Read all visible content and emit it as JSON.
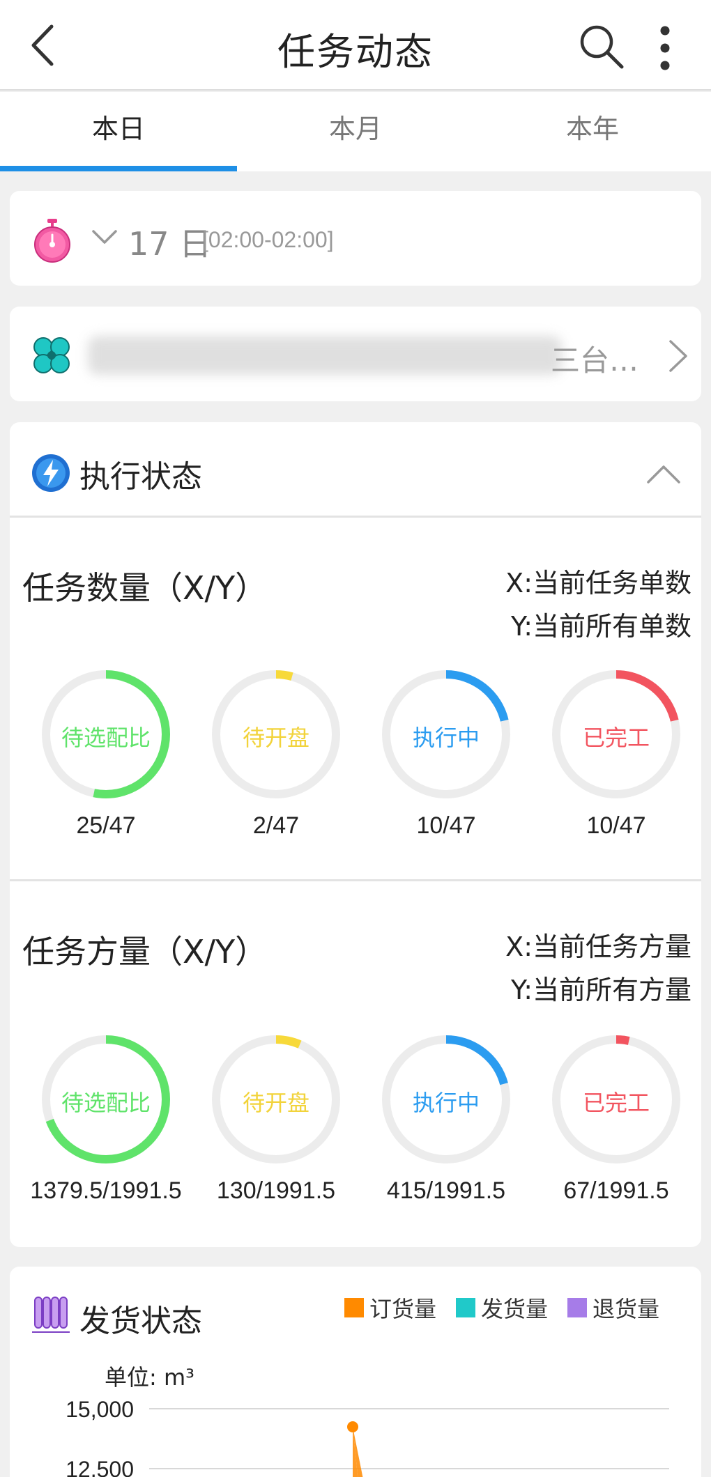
{
  "header": {
    "title": "任务动态"
  },
  "tabs": [
    {
      "label": "本日",
      "active": true
    },
    {
      "label": "本月",
      "active": false
    },
    {
      "label": "本年",
      "active": false
    }
  ],
  "date_filter": {
    "day": "17 日",
    "range": "[02:00-02:00]"
  },
  "station": {
    "visible_text": "三台…"
  },
  "exec_status": {
    "title": "执行状态",
    "task_count": {
      "title": "任务数量（X/Y）",
      "legend_x": "X:当前任务单数",
      "legend_y": "Y:当前所有单数",
      "items": [
        {
          "label": "待选配比",
          "value": "25/47",
          "fraction": 0.532,
          "color": "#5fe36a"
        },
        {
          "label": "待开盘",
          "value": "2/47",
          "fraction": 0.043,
          "color": "#f7d93a"
        },
        {
          "label": "执行中",
          "value": "10/47",
          "fraction": 0.213,
          "color": "#2b9cf0"
        },
        {
          "label": "已完工",
          "value": "10/47",
          "fraction": 0.213,
          "color": "#f2545f"
        }
      ]
    },
    "task_volume": {
      "title": "任务方量（X/Y）",
      "legend_x": "X:当前任务方量",
      "legend_y": "Y:当前所有方量",
      "items": [
        {
          "label": "待选配比",
          "value": "1379.5/1991.5",
          "fraction": 0.693,
          "color": "#5fe36a"
        },
        {
          "label": "待开盘",
          "value": "130/1991.5",
          "fraction": 0.065,
          "color": "#f7d93a"
        },
        {
          "label": "执行中",
          "value": "415/1991.5",
          "fraction": 0.208,
          "color": "#2b9cf0"
        },
        {
          "label": "已完工",
          "value": "67/1991.5",
          "fraction": 0.034,
          "color": "#f2545f"
        }
      ]
    }
  },
  "ship_status": {
    "title": "发货状态",
    "unit": "单位: m³",
    "legend": [
      {
        "label": "订货量",
        "color": "#ff8a00"
      },
      {
        "label": "发货量",
        "color": "#20c9c9"
      },
      {
        "label": "退货量",
        "color": "#a67ce8"
      }
    ],
    "yticks": [
      "15,000",
      "12,500"
    ]
  },
  "colors": {
    "accent": "#1e8fe6",
    "ring_track": "#ececec"
  }
}
